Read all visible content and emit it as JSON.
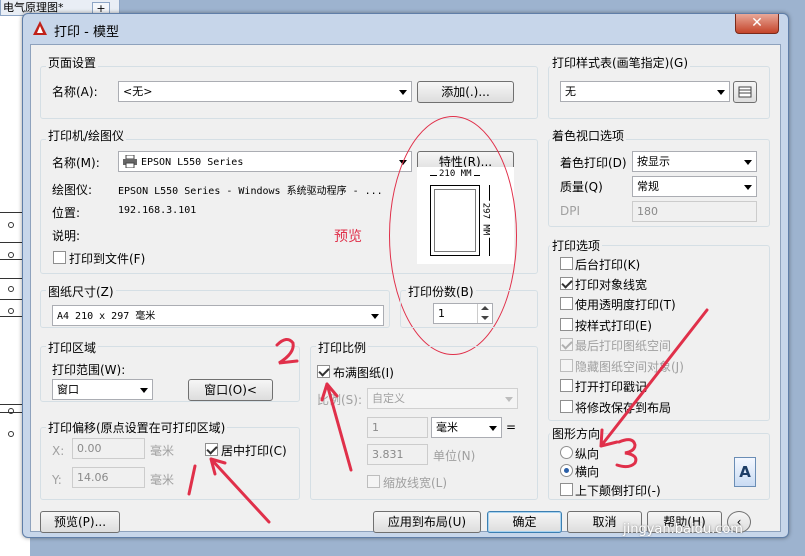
{
  "background": {
    "tab_title": "电气原理图*",
    "new_tab": "+"
  },
  "window": {
    "title": "打印 - 模型",
    "close": "✕"
  },
  "page_setup": {
    "group": "页面设置",
    "name_label": "名称(A):",
    "name_value": "<无>",
    "add_button": "添加(.)..."
  },
  "printer": {
    "group": "打印机/绘图仪",
    "name_label": "名称(M):",
    "name_value": "EPSON L550 Series",
    "properties_button": "特性(R)...",
    "plotter_label": "绘图仪:",
    "plotter_value": "EPSON L550 Series - Windows 系统驱动程序 - ...",
    "location_label": "位置:",
    "location_value": "192.168.3.101",
    "description_label": "说明:",
    "print_to_file": "打印到文件(F)",
    "preview_width": "210 MM",
    "preview_height": "297 MM"
  },
  "annotations": {
    "preview_note": "预览",
    "watermark": "jingyan.baidu.com"
  },
  "paper": {
    "group": "图纸尺寸(Z)",
    "value": "A4 210 x 297 毫米",
    "copies_label": "打印份数(B)",
    "copies_value": "1"
  },
  "print_area": {
    "group": "打印区域",
    "range_label": "打印范围(W):",
    "range_value": "窗口",
    "window_button": "窗口(O)<"
  },
  "print_offset": {
    "group": "打印偏移(原点设置在可打印区域)",
    "x_label": "X:",
    "x_value": "0.00",
    "x_unit": "毫米",
    "y_label": "Y:",
    "y_value": "14.06",
    "y_unit": "毫米",
    "center": "居中打印(C)"
  },
  "print_scale": {
    "group": "打印比例",
    "fit_paper": "布满图纸(I)",
    "scale_label": "比例(S):",
    "scale_value": "自定义",
    "value1": "1",
    "unit1": "毫米",
    "equals": "=",
    "value2": "3.831",
    "unit2": "单位(N)",
    "scale_lineweights": "缩放线宽(L)"
  },
  "plot_style": {
    "group": "打印样式表(画笔指定)(G)",
    "value": "无"
  },
  "shaded_viewport": {
    "group": "着色视口选项",
    "shade_label": "着色打印(D)",
    "shade_value": "按显示",
    "quality_label": "质量(Q)",
    "quality_value": "常规",
    "dpi_label": "DPI",
    "dpi_value": "180"
  },
  "plot_options": {
    "group": "打印选项",
    "items": [
      {
        "label": "后台打印(K)",
        "checked": false,
        "enabled": true
      },
      {
        "label": "打印对象线宽",
        "checked": true,
        "enabled": true
      },
      {
        "label": "使用透明度打印(T)",
        "checked": false,
        "enabled": true
      },
      {
        "label": "按样式打印(E)",
        "checked": false,
        "enabled": true
      },
      {
        "label": "最后打印图纸空间",
        "checked": true,
        "enabled": false
      },
      {
        "label": "隐藏图纸空间对象(J)",
        "checked": false,
        "enabled": false
      },
      {
        "label": "打开打印戳记",
        "checked": false,
        "enabled": true
      },
      {
        "label": "将修改保存到布局",
        "checked": false,
        "enabled": true
      }
    ]
  },
  "orientation": {
    "group": "图形方向",
    "portrait": "纵向",
    "landscape": "横向",
    "selected": "landscape",
    "upside_down": "上下颠倒打印(-)",
    "icon_letter": "A"
  },
  "buttons": {
    "preview": "预览(P)...",
    "apply_layout": "应用到布局(U)",
    "ok": "确定",
    "cancel": "取消",
    "help": "帮助(H)"
  },
  "accent_color": "#e0304a"
}
